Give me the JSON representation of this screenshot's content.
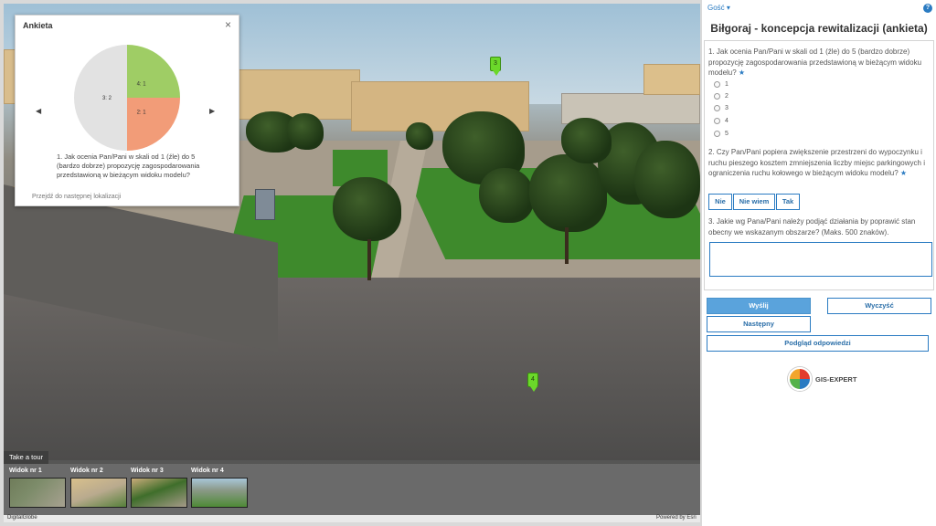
{
  "popup": {
    "title": "Ankieta",
    "close_glyph": "×",
    "prev_glyph": "◀",
    "next_glyph": "▶",
    "question": "1. Jak ocenia Pan/Pani w skali od 1 (źle) do 5 (bardzo dobrze) propozycję zagospodarowania przedstawioną w bieżącym widoku modelu?",
    "next_location_link": "Przejdź do następnej lokalizacji"
  },
  "chart_data": {
    "type": "pie",
    "slices": [
      {
        "label": "4: 1",
        "value": 1,
        "color": "#9fcd65"
      },
      {
        "label": "2: 1",
        "value": 1,
        "color": "#f29c78"
      },
      {
        "label": "3: 2",
        "value": 2,
        "color": "#e2e2e2"
      }
    ]
  },
  "scene": {
    "markers": [
      "3",
      "4"
    ]
  },
  "tour": {
    "tab_label": "Take a tour",
    "views": [
      {
        "label": "Widok nr 1"
      },
      {
        "label": "Widok nr 2"
      },
      {
        "label": "Widok nr 3"
      },
      {
        "label": "Widok nr 4"
      }
    ]
  },
  "credits": {
    "left": "DigitalGlobe",
    "right": "Powered by Esri"
  },
  "panel": {
    "guest_label": "Gość ▾",
    "help_glyph": "?",
    "title": "Biłgoraj - koncepcja rewitalizacji (ankieta)",
    "q1": "1. Jak ocenia Pan/Pani w skali od 1 (źle) do 5 (bardzo dobrze) propozycję zagospodarowania przedstawioną w bieżącym widoku modelu?",
    "q1_options": [
      "1",
      "2",
      "3",
      "4",
      "5"
    ],
    "q2": "2. Czy Pan/Pani popiera zwiększenie przestrzeni do wypoczynku i ruchu pieszego kosztem zmniejszenia liczby miejsc parkingowych i ograniczenia ruchu kołowego w bieżącym widoku modelu?",
    "q2_options": [
      "Nie",
      "Nie wiem",
      "Tak"
    ],
    "q3": "3. Jakie wg Pana/Pani należy podjąć działania by poprawić stan obecny we wskazanym obszarze? (Maks. 500 znaków).",
    "required_mark": "★",
    "submit_label": "Wyślij",
    "clear_label": "Wyczyść",
    "next_label": "Następny",
    "preview_label": "Podgląd odpowiedzi",
    "logo_text": "GIS-EXPERT"
  }
}
